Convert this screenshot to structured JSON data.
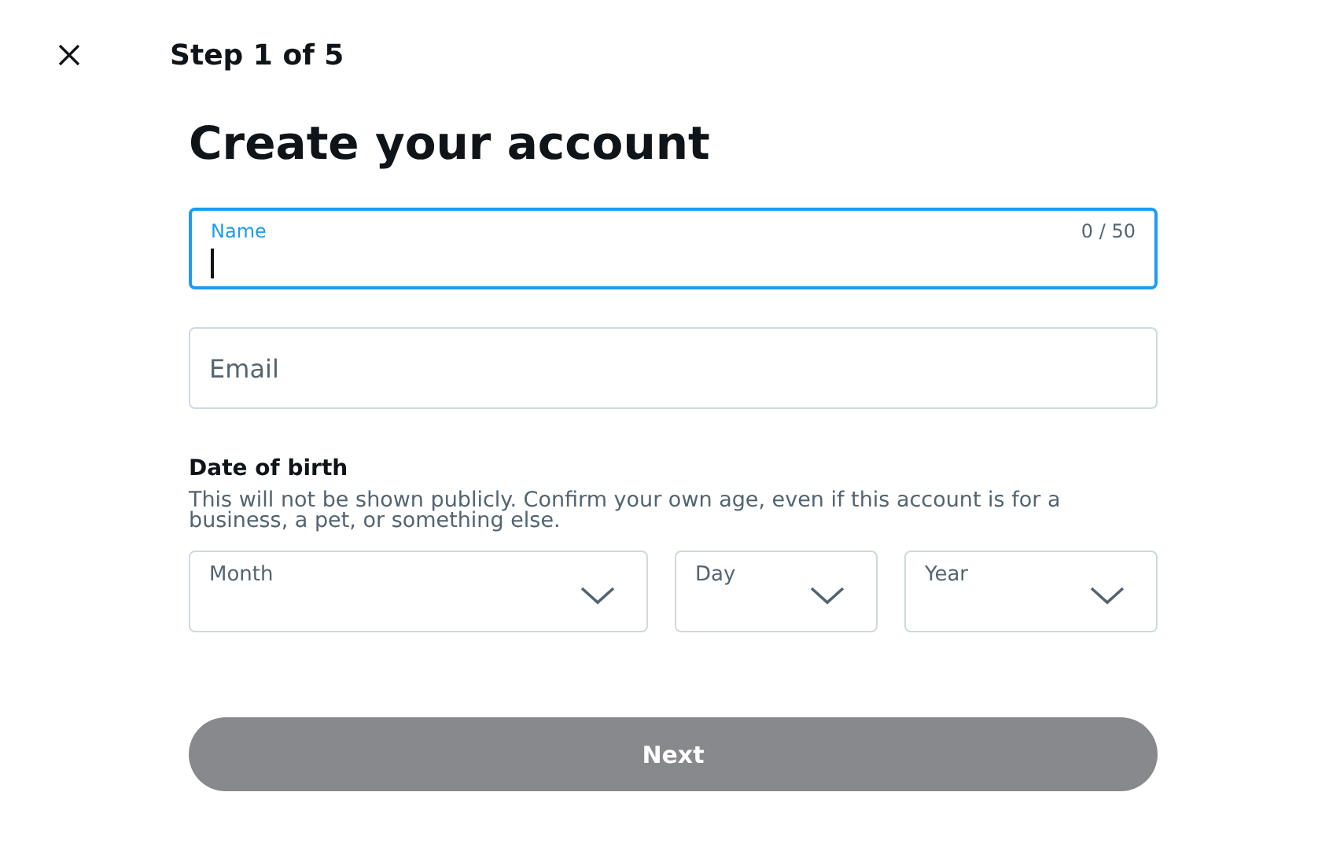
{
  "header": {
    "step": "Step 1 of 5"
  },
  "title": "Create your account",
  "name_field": {
    "label": "Name",
    "counter": "0 / 50",
    "focused": true
  },
  "email_field": {
    "placeholder": "Email",
    "focused": false
  },
  "date_of_birth": {
    "label": "Date of birth",
    "description": "This will not be shown publicly. Confirm your own age, even if this account is for a business, a pet, or something else.",
    "selects": [
      {
        "label": "Month",
        "kind": "wide"
      },
      {
        "label": "Day",
        "kind": "narrow"
      },
      {
        "label": "Year",
        "kind": "medium"
      }
    ]
  },
  "next_button": {
    "label": "Next",
    "disabled": true
  }
}
